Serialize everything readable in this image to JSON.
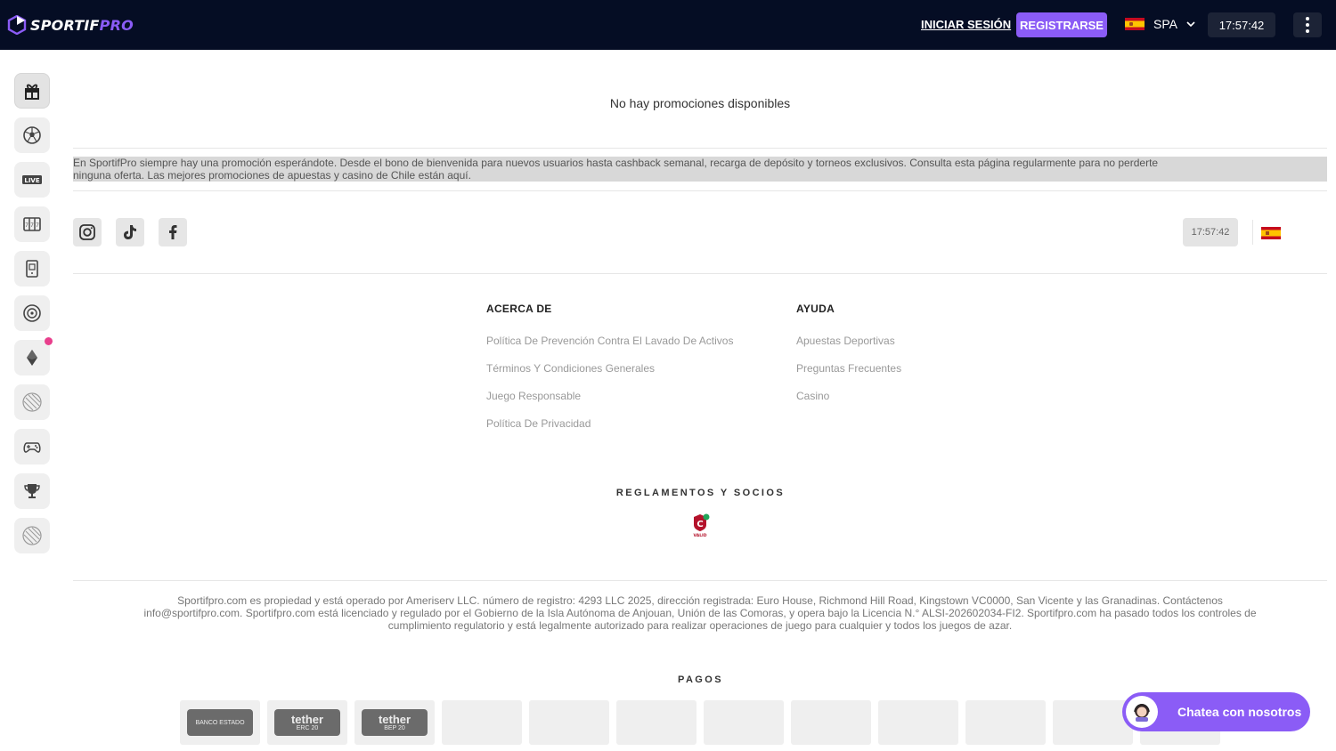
{
  "header": {
    "logo_main": "SPORTIF",
    "logo_accent": "PRO",
    "login_label": "INICIAR SESIÓN",
    "register_label": "REGISTRARSE",
    "language": "SPA",
    "clock": "17:57:42"
  },
  "sidebar": {
    "items": [
      {
        "icon": "gift-icon",
        "active": true
      },
      {
        "icon": "soccer-ball-icon"
      },
      {
        "icon": "live-icon",
        "label": "LIVE"
      },
      {
        "icon": "slot-machine-icon"
      },
      {
        "icon": "mobile-game-icon"
      },
      {
        "icon": "roulette-icon"
      },
      {
        "icon": "diamond-icon",
        "badge": true
      },
      {
        "icon": "placeholder-icon"
      },
      {
        "icon": "gamepad-icon"
      },
      {
        "icon": "trophy-icon"
      },
      {
        "icon": "placeholder-icon"
      }
    ]
  },
  "promotions": {
    "empty_message": "No hay promociones disponibles",
    "description_line1": "En SportifPro siempre hay una promoción esperándote. Desde el bono de bienvenida para nuevos usuarios hasta cashback semanal, recarga de depósito y torneos exclusivos. Consulta esta página regularmente para no perderte",
    "description_line2": "ninguna oferta. Las mejores promociones de apuestas y casino de Chile están aquí."
  },
  "footer": {
    "clock": "17:57:42",
    "social": [
      "instagram-icon",
      "tiktok-icon",
      "facebook-icon"
    ],
    "about": {
      "heading": "ACERCA DE",
      "links": [
        "Política De Prevención Contra El Lavado De Activos",
        "Términos Y Condiciones Generales",
        "Juego Responsable",
        "Política De Privacidad"
      ]
    },
    "help": {
      "heading": "AYUDA",
      "links": [
        "Apuestas Deportivas",
        "Preguntas Frecuentes",
        "Casino"
      ]
    },
    "regulations_heading": "REGLAMENTOS Y SOCIOS",
    "partner_badge_text": "VALID",
    "legal_line1": "Sportifpro.com es propiedad y está operado por Ameriserv LLC. número de registro: 4293 LLC 2025, dirección registrada: Euro House, Richmond Hill Road, Kingstown VC0000, San Vicente y las Granadinas. Contáctenos",
    "legal_line2": "info@sportifpro.com. Sportifpro.com está licenciado y regulado por el Gobierno de la Isla Autónoma de Anjouan, Unión de las Comoras, y opera bajo la Licencia N.° ALSI-202602034-FI2. Sportifpro.com ha pasado todos los controles de",
    "legal_line3": "cumplimiento regulatorio y está legalmente autorizado para realizar operaciones de juego para cualquier y todos los juegos de azar.",
    "payments_heading": "PAGOS",
    "payments": [
      {
        "name": "BANCO ESTADO",
        "sub": ""
      },
      {
        "name": "tether",
        "sub": "ERC 20"
      },
      {
        "name": "tether",
        "sub": "BEP 20"
      }
    ]
  },
  "chat": {
    "label": "Chatea con nosotros"
  },
  "colors": {
    "header_bg": "#050d24",
    "accent": "#8b5cf6",
    "notification": "#e83e8c"
  }
}
